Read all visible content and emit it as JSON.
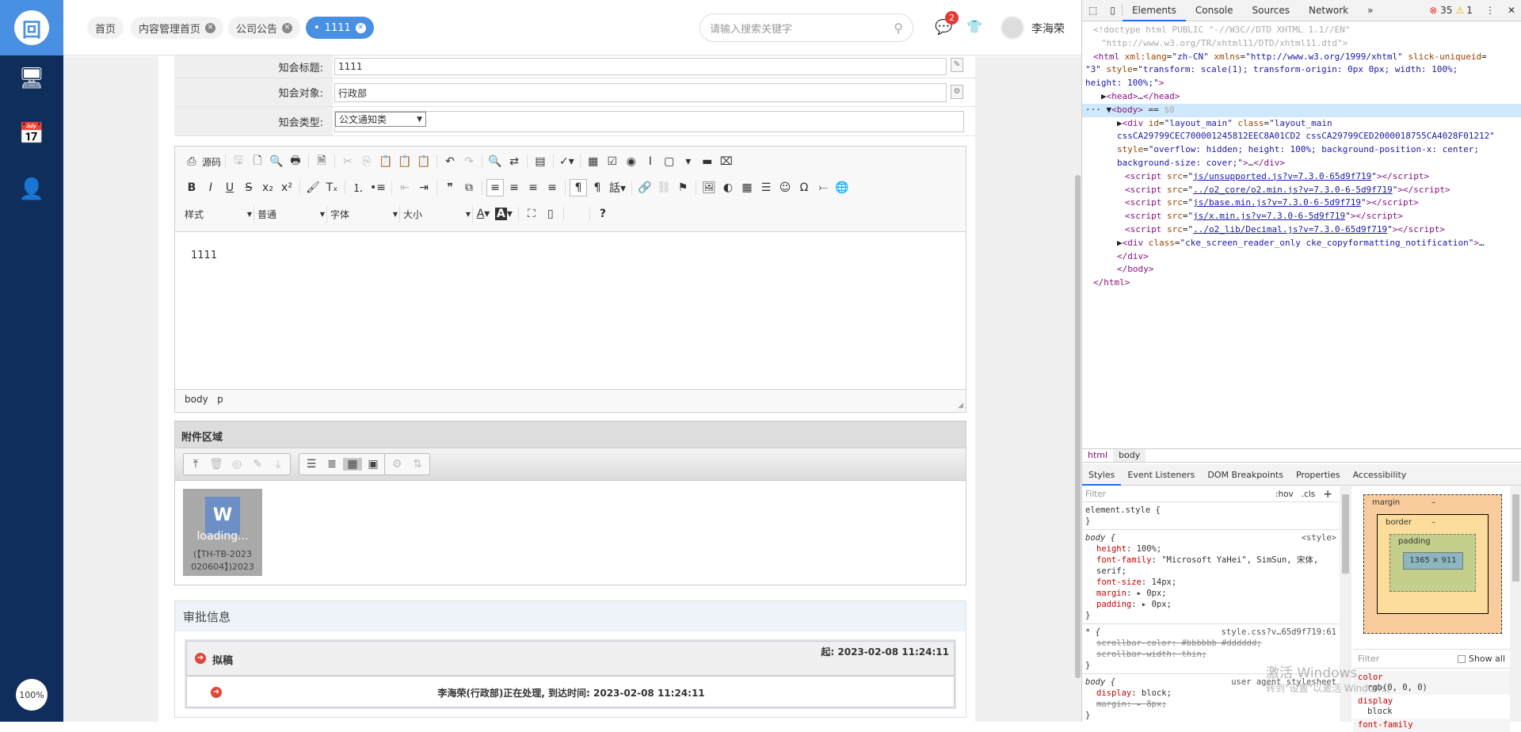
{
  "sidebar": {
    "logo": "回",
    "icons": [
      "monitor-user-icon",
      "calendar-icon",
      "user-settings-icon"
    ],
    "zoom": "100%"
  },
  "header": {
    "tabs": [
      {
        "label": "首页",
        "closable": false
      },
      {
        "label": "内容管理首页",
        "closable": true
      },
      {
        "label": "公司公告",
        "closable": true
      },
      {
        "label": "1111",
        "closable": true,
        "active": true
      }
    ],
    "search_placeholder": "请输入搜索关键字",
    "notification_count": "2",
    "user_name": "李海荣"
  },
  "form": {
    "rows": [
      {
        "label": "知会标题:",
        "value": "1111"
      },
      {
        "label": "知会对象:",
        "value": "行政部"
      },
      {
        "label": "知会类型:",
        "value": "公文通知类"
      }
    ]
  },
  "editor": {
    "source_label": "源码",
    "combos": [
      "样式",
      "普通",
      "字体",
      "大小"
    ],
    "content": "1111",
    "path": [
      "body",
      "p"
    ]
  },
  "attachment": {
    "title": "附件区域",
    "file": {
      "status": "loading...",
      "name_line1": "(【TH-TB-2023",
      "name_line2": "020604】)2023"
    }
  },
  "approval": {
    "title": "审批信息",
    "step": "拟稿",
    "start": "起: 2023-02-08 11:24:11",
    "detail": "李海荣(行政部)正在处理, 到达时间: 2023-02-08 11:24:11"
  },
  "devtools": {
    "tabs": [
      "Elements",
      "Console",
      "Sources",
      "Network",
      "»"
    ],
    "errors": "35",
    "warnings": "1",
    "dom": [
      {
        "i": 1,
        "s": [
          [
            "cm",
            "<!doctype html PUBLIC \"-//W3C//DTD XHTML 1.1//EN\""
          ]
        ]
      },
      {
        "i": 2,
        "s": [
          [
            "cm",
            "\"http://www.w3.org/TR/xhtml11/DTD/xhtml11.dtd\">"
          ]
        ]
      },
      {
        "i": 1,
        "s": [
          [
            "tg",
            "<html "
          ],
          [
            "an",
            "xml:lang"
          ],
          [
            "pl",
            "="
          ],
          [
            "av",
            "\"zh-CN\" "
          ],
          [
            "an",
            "xmlns"
          ],
          [
            "pl",
            "="
          ],
          [
            "av",
            "\"http://www.w3.org/1999/xhtml\" "
          ],
          [
            "an",
            "slick-uniqueid"
          ],
          [
            "pl",
            "="
          ]
        ]
      },
      {
        "i": 0,
        "s": [
          [
            "av",
            "\"3\" "
          ],
          [
            "an",
            "style"
          ],
          [
            "pl",
            "="
          ],
          [
            "av",
            "\"transform: scale(1); transform-origin: 0px 0px; width: 100%;"
          ]
        ]
      },
      {
        "i": 0,
        "s": [
          [
            "av",
            "height: 100%;\""
          ],
          [
            "tg",
            ">"
          ]
        ]
      },
      {
        "i": 2,
        "s": [
          [
            "pl",
            "▶"
          ],
          [
            "tg",
            "<head>"
          ],
          [
            "pl",
            "…"
          ],
          [
            "tg",
            "</head>"
          ]
        ]
      },
      {
        "i": 0,
        "sel": true,
        "s": [
          [
            "pl",
            "··· ▼"
          ],
          [
            "tg",
            "<body>"
          ],
          [
            "pl",
            " == "
          ],
          [
            "cm",
            "$0"
          ]
        ]
      },
      {
        "i": 4,
        "s": [
          [
            "pl",
            "▶"
          ],
          [
            "tg",
            "<div "
          ],
          [
            "an",
            "id"
          ],
          [
            "pl",
            "="
          ],
          [
            "av",
            "\"layout_main\" "
          ],
          [
            "an",
            "class"
          ],
          [
            "pl",
            "="
          ],
          [
            "av",
            "\"layout_main"
          ]
        ]
      },
      {
        "i": 4,
        "s": [
          [
            "av",
            "cssCA29799CEC700001245812EEC8A01CD2 cssCA29799CED2000018755CA4028F01212\""
          ]
        ]
      },
      {
        "i": 4,
        "s": [
          [
            "an",
            "style"
          ],
          [
            "pl",
            "="
          ],
          [
            "av",
            "\"overflow: hidden; height: 100%; background-position-x: center;"
          ]
        ]
      },
      {
        "i": 4,
        "s": [
          [
            "av",
            "background-size: cover;\""
          ],
          [
            "tg",
            ">"
          ],
          [
            "pl",
            "…"
          ],
          [
            "tg",
            "</div>"
          ]
        ]
      },
      {
        "i": 5,
        "s": [
          [
            "tg",
            "<script "
          ],
          [
            "an",
            "src"
          ],
          [
            "pl",
            "=\""
          ],
          [
            "lk",
            "js/unsupported.js?v=7.3.0-65d9f719"
          ],
          [
            "pl",
            "\""
          ],
          [
            "tg",
            "></script>"
          ]
        ]
      },
      {
        "i": 5,
        "s": [
          [
            "tg",
            "<script "
          ],
          [
            "an",
            "src"
          ],
          [
            "pl",
            "=\""
          ],
          [
            "lk",
            "../o2_core/o2.min.js?v=7.3.0-6-5d9f719"
          ],
          [
            "pl",
            "\""
          ],
          [
            "tg",
            "></script>"
          ]
        ]
      },
      {
        "i": 5,
        "s": [
          [
            "tg",
            "<script "
          ],
          [
            "an",
            "src"
          ],
          [
            "pl",
            "=\""
          ],
          [
            "lk",
            "js/base.min.js?v=7.3.0-6-5d9f719"
          ],
          [
            "pl",
            "\""
          ],
          [
            "tg",
            "></script>"
          ]
        ]
      },
      {
        "i": 5,
        "s": [
          [
            "tg",
            "<script "
          ],
          [
            "an",
            "src"
          ],
          [
            "pl",
            "=\""
          ],
          [
            "lk",
            "js/x.min.js?v=7.3.0-6-5d9f719"
          ],
          [
            "pl",
            "\""
          ],
          [
            "tg",
            "></script>"
          ]
        ]
      },
      {
        "i": 5,
        "s": [
          [
            "tg",
            "<script "
          ],
          [
            "an",
            "src"
          ],
          [
            "pl",
            "=\""
          ],
          [
            "lk",
            "../o2_lib/Decimal.js?v=7.3.0-65d9f719"
          ],
          [
            "pl",
            "\""
          ],
          [
            "tg",
            "></script>"
          ]
        ]
      },
      {
        "i": 4,
        "s": [
          [
            "pl",
            "▶"
          ],
          [
            "tg",
            "<div "
          ],
          [
            "an",
            "class"
          ],
          [
            "pl",
            "="
          ],
          [
            "av",
            "\"cke_screen_reader_only cke_copyformatting_notification\""
          ],
          [
            "tg",
            ">"
          ],
          [
            "pl",
            "…"
          ]
        ]
      },
      {
        "i": 4,
        "s": [
          [
            "tg",
            "</div>"
          ]
        ]
      },
      {
        "i": 4,
        "s": [
          [
            "tg",
            "</body>"
          ]
        ]
      },
      {
        "i": 1,
        "s": [
          [
            "tg",
            "</html>"
          ]
        ]
      }
    ],
    "breadcrumb": [
      "html",
      "body"
    ],
    "style_tabs": [
      "Styles",
      "Event Listeners",
      "DOM Breakpoints",
      "Properties",
      "Accessibility"
    ],
    "filter_placeholder": "Filter",
    "hov": ":hov",
    "cls": ".cls",
    "rules": [
      {
        "sel": "element.style {",
        "src": "",
        "props": []
      },
      {
        "sel": "body {",
        "src": "<style>",
        "props": [
          [
            "height",
            "100%;",
            false
          ],
          [
            "font-family",
            "\"Microsoft YaHei\", SimSun, 宋体, serif;",
            false
          ],
          [
            "font-size",
            "14px;",
            false
          ],
          [
            "margin",
            "▸ 0px;",
            false
          ],
          [
            "padding",
            "▸ 0px;",
            false
          ]
        ]
      },
      {
        "sel": "* {",
        "src": "style.css?v…65d9f719:61",
        "props": [
          [
            "scrollbar-color",
            "#bbbbbb #dddddd;",
            true
          ],
          [
            "scrollbar-width",
            "thin;",
            true
          ]
        ]
      },
      {
        "sel": "body {",
        "src": "user agent stylesheet",
        "props": [
          [
            "display",
            "block;",
            false
          ],
          [
            "margin",
            "▸ 8px;",
            true
          ]
        ]
      }
    ],
    "box": {
      "margin": "margin",
      "border": "border",
      "padding": "padding",
      "dash": "–",
      "size": "1365 × 911"
    },
    "computed": {
      "filter": "Filter",
      "show_all": "Show all",
      "props": [
        [
          "color",
          "rgb(0, 0, 0)"
        ],
        [
          "display",
          "block"
        ],
        [
          "font-family",
          ""
        ]
      ]
    },
    "watermark": [
      "激活 Windows",
      "转到\"设置\"以激活 Windows。"
    ]
  }
}
